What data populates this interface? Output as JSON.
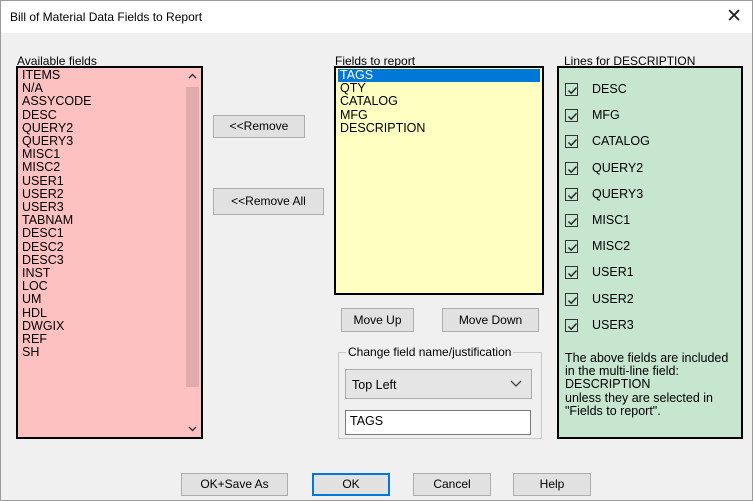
{
  "window": {
    "title": "Bill of Material Data Fields to Report",
    "close_glyph": "✕"
  },
  "available": {
    "label": "Available fields",
    "items": [
      "ITEMS",
      "N/A",
      "ASSYCODE",
      "DESC",
      "QUERY2",
      "QUERY3",
      "MISC1",
      "MISC2",
      "USER1",
      "USER2",
      "USER3",
      "TABNAM",
      "DESC1",
      "DESC2",
      "DESC3",
      "INST",
      "LOC",
      "UM",
      "HDL",
      "DWGIX",
      "REF",
      "SH"
    ],
    "bg_color": "#fdc1c1"
  },
  "buttons": {
    "remove": "<<Remove",
    "remove_all": "<<Remove All",
    "move_up": "Move Up",
    "move_down": "Move Down",
    "ok_save_as": "OK+Save As",
    "ok": "OK",
    "cancel": "Cancel",
    "help": "Help"
  },
  "report": {
    "label": "Fields to report",
    "items": [
      "TAGS",
      "QTY",
      "CATALOG",
      "MFG",
      "DESCRIPTION"
    ],
    "selected": "TAGS",
    "bg_color": "#ffffc1"
  },
  "change": {
    "label": "Change field name/justification",
    "justification": "Top Left",
    "field_name": "TAGS"
  },
  "lines": {
    "label": "Lines for DESCRIPTION",
    "items": [
      "DESC",
      "MFG",
      "CATALOG",
      "QUERY2",
      "QUERY3",
      "MISC1",
      "MISC2",
      "USER1",
      "USER2",
      "USER3"
    ],
    "checked": [
      true,
      true,
      true,
      true,
      true,
      true,
      true,
      true,
      true,
      true
    ],
    "note": [
      "The above fields are included",
      "in the multi-line field:",
      "DESCRIPTION",
      "unless they are selected in",
      "\"Fields to report\"."
    ],
    "bg_color": "#c6e6d0"
  },
  "icons": {
    "scroll_up": "chevron-up-icon",
    "scroll_down": "chevron-down-icon",
    "dropdown": "chevron-down-icon",
    "check": "check-icon"
  }
}
